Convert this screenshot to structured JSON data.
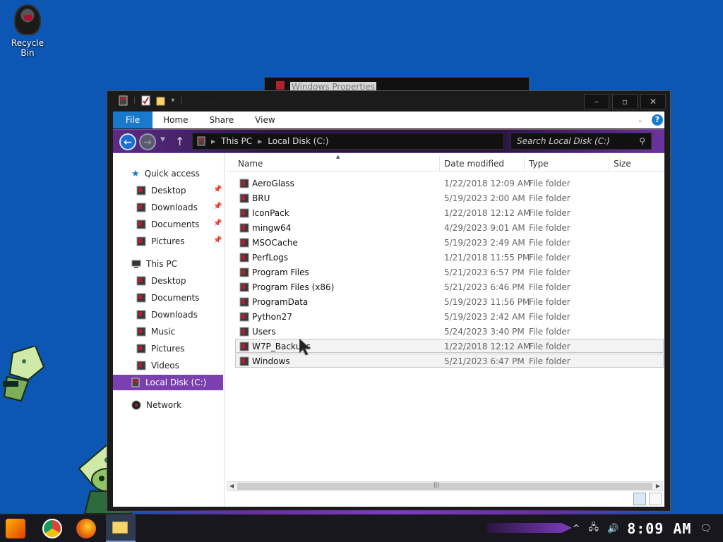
{
  "desktop": {
    "recycle_bin_label": "Recycle Bin"
  },
  "background_window": {
    "title": "Windows Properties"
  },
  "window": {
    "title": "Local Disk (C:)",
    "controls": {
      "minimize": "–",
      "maximize": "▫",
      "close": "✕"
    }
  },
  "ribbon": {
    "tabs": [
      "File",
      "Home",
      "Share",
      "View"
    ]
  },
  "address": {
    "crumbs": [
      "This PC",
      "Local Disk (C:)"
    ]
  },
  "search": {
    "placeholder": "Search Local Disk (C:)"
  },
  "sidebar": {
    "quick_access": "Quick access",
    "quick_items": [
      "Desktop",
      "Downloads",
      "Documents",
      "Pictures"
    ],
    "this_pc": "This PC",
    "pc_items": [
      "Desktop",
      "Documents",
      "Downloads",
      "Music",
      "Pictures",
      "Videos"
    ],
    "local_disk": "Local Disk (C:)",
    "network": "Network"
  },
  "columns": {
    "name": "Name",
    "date": "Date modified",
    "type": "Type",
    "size": "Size"
  },
  "files": [
    {
      "name": "AeroGlass",
      "date": "1/22/2018 12:09 AM",
      "type": "File folder"
    },
    {
      "name": "BRU",
      "date": "5/19/2023 2:00 AM",
      "type": "File folder"
    },
    {
      "name": "IconPack",
      "date": "1/22/2018 12:12 AM",
      "type": "File folder"
    },
    {
      "name": "mingw64",
      "date": "4/29/2023 9:01 AM",
      "type": "File folder"
    },
    {
      "name": "MSOCache",
      "date": "5/19/2023 2:49 AM",
      "type": "File folder"
    },
    {
      "name": "PerfLogs",
      "date": "1/21/2018 11:55 PM",
      "type": "File folder"
    },
    {
      "name": "Program Files",
      "date": "5/21/2023 6:57 PM",
      "type": "File folder"
    },
    {
      "name": "Program Files (x86)",
      "date": "5/21/2023 6:46 PM",
      "type": "File folder"
    },
    {
      "name": "ProgramData",
      "date": "5/19/2023 11:56 PM",
      "type": "File folder"
    },
    {
      "name": "Python27",
      "date": "5/19/2023 2:42 AM",
      "type": "File folder"
    },
    {
      "name": "Users",
      "date": "5/24/2023 3:40 PM",
      "type": "File folder"
    },
    {
      "name": "W7P_Backups",
      "date": "1/22/2018 12:12 AM",
      "type": "File folder"
    },
    {
      "name": "Windows",
      "date": "5/21/2023 6:47 PM",
      "type": "File folder"
    }
  ],
  "taskbar": {
    "clock": "8:09 AM"
  },
  "colors": {
    "desktop": "#0c56b4",
    "accent_purple": "#7a3fb0",
    "file_tab": "#1979ca"
  }
}
